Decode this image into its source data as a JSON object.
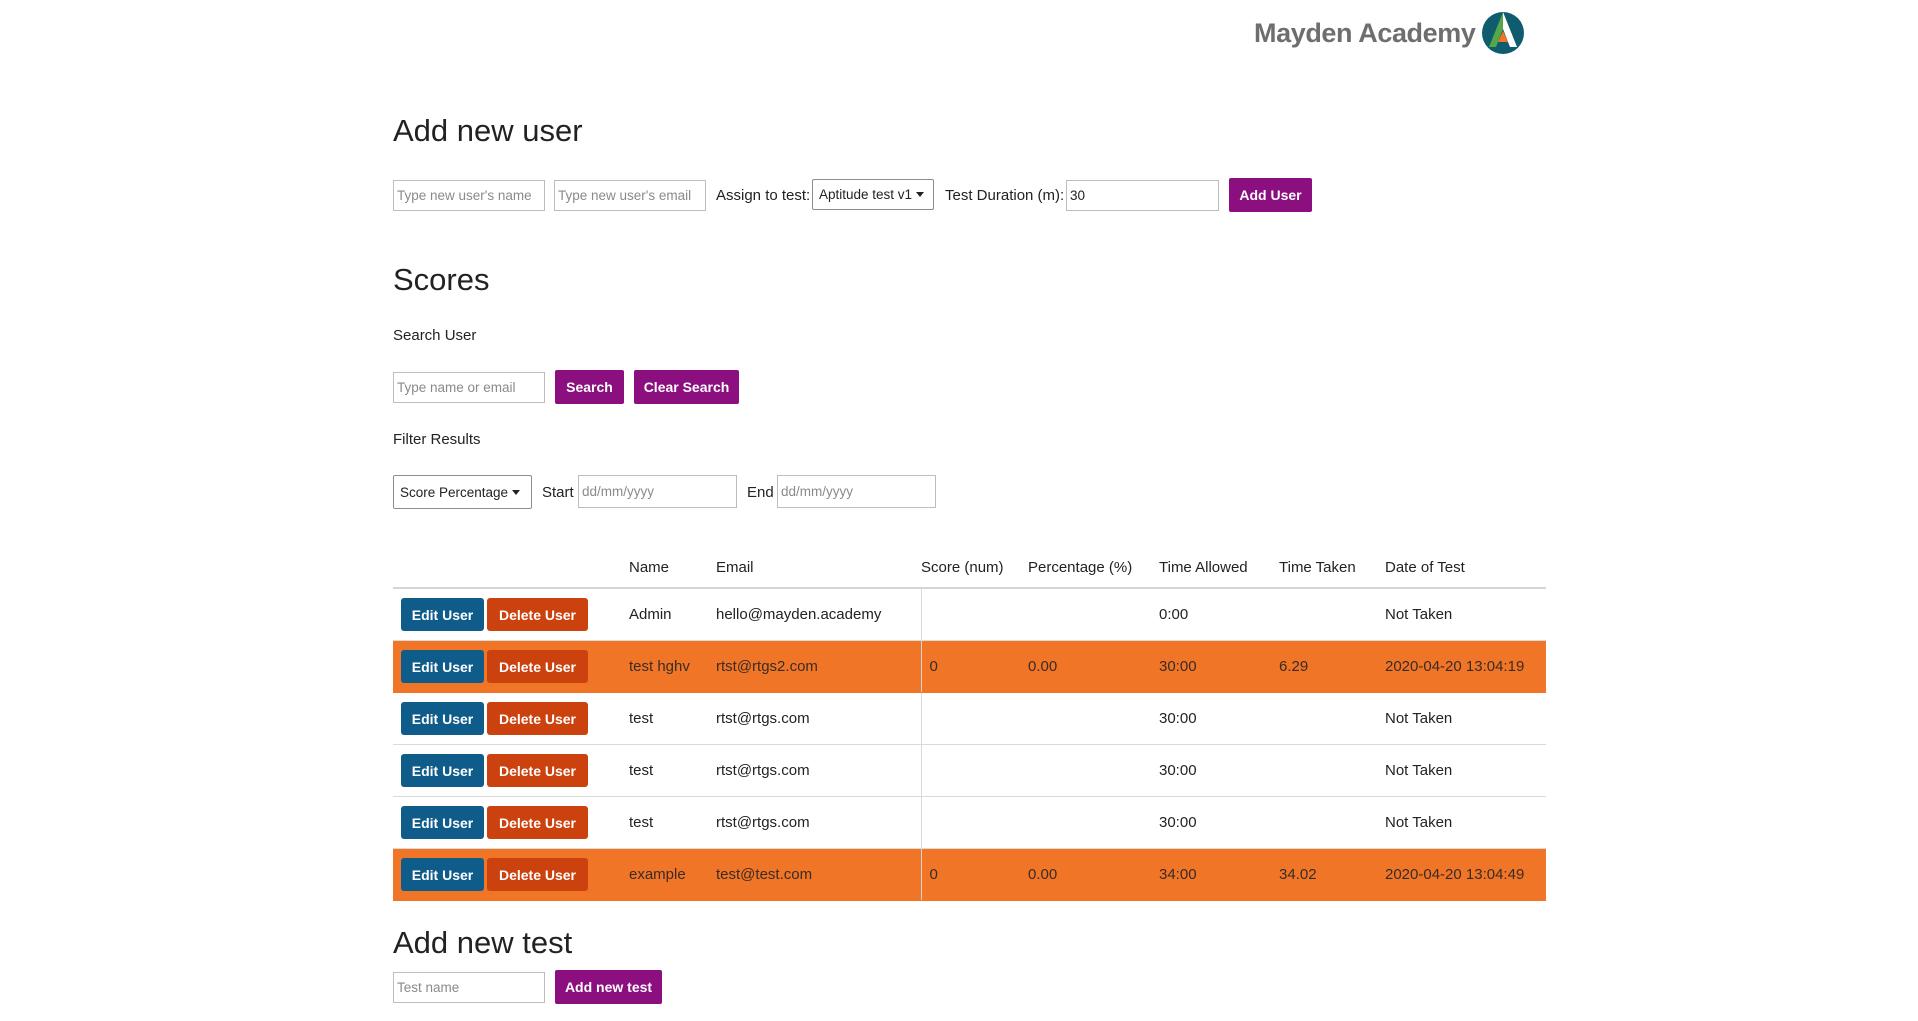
{
  "brand": {
    "name": "Mayden Academy"
  },
  "add_user": {
    "title": "Add new user",
    "name_placeholder": "Type new user's name",
    "email_placeholder": "Type new user's email",
    "assign_label": "Assign to test:",
    "test_selected": "Aptitude test v1",
    "duration_label": "Test Duration (m):",
    "duration_value": "30",
    "submit_label": "Add User"
  },
  "scores": {
    "title": "Scores",
    "search_label": "Search User",
    "search_placeholder": "Type name or email",
    "search_button": "Search",
    "clear_button": "Clear Search",
    "filter_label": "Filter Results",
    "filter_selected": "Score Percentage",
    "start_label": "Start",
    "start_placeholder": "dd/mm/yyyy",
    "end_label": "End",
    "end_placeholder": "dd/mm/yyyy",
    "columns": [
      "Name",
      "Email",
      "Score (num)",
      "Percentage (%)",
      "Time Allowed",
      "Time Taken",
      "Date of Test"
    ],
    "edit_label": "Edit User",
    "delete_label": "Delete User",
    "rows": [
      {
        "name": "Admin",
        "email": "hello@mayden.academy",
        "score": "",
        "percentage": "",
        "time_allowed": "0:00",
        "time_taken": "",
        "date": "Not Taken",
        "taken": false
      },
      {
        "name": "test hghv",
        "email": "rtst@rtgs2.com",
        "score": "0",
        "percentage": "0.00",
        "time_allowed": "30:00",
        "time_taken": "6.29",
        "date": "2020-04-20 13:04:19",
        "taken": true
      },
      {
        "name": "test",
        "email": "rtst@rtgs.com",
        "score": "",
        "percentage": "",
        "time_allowed": "30:00",
        "time_taken": "",
        "date": "Not Taken",
        "taken": false
      },
      {
        "name": "test",
        "email": "rtst@rtgs.com",
        "score": "",
        "percentage": "",
        "time_allowed": "30:00",
        "time_taken": "",
        "date": "Not Taken",
        "taken": false
      },
      {
        "name": "test",
        "email": "rtst@rtgs.com",
        "score": "",
        "percentage": "",
        "time_allowed": "30:00",
        "time_taken": "",
        "date": "Not Taken",
        "taken": false
      },
      {
        "name": "example",
        "email": "test@test.com",
        "score": "0",
        "percentage": "0.00",
        "time_allowed": "34:00",
        "time_taken": "34.02",
        "date": "2020-04-20 13:04:49",
        "taken": true
      }
    ]
  },
  "add_test": {
    "title": "Add new test",
    "name_placeholder": "Test name",
    "submit_label": "Add new test"
  },
  "colors": {
    "primary_button": "#8b0f7f",
    "edit_button": "#0f5c8b",
    "delete_button": "#cc420f",
    "taken_row": "#f07526"
  }
}
